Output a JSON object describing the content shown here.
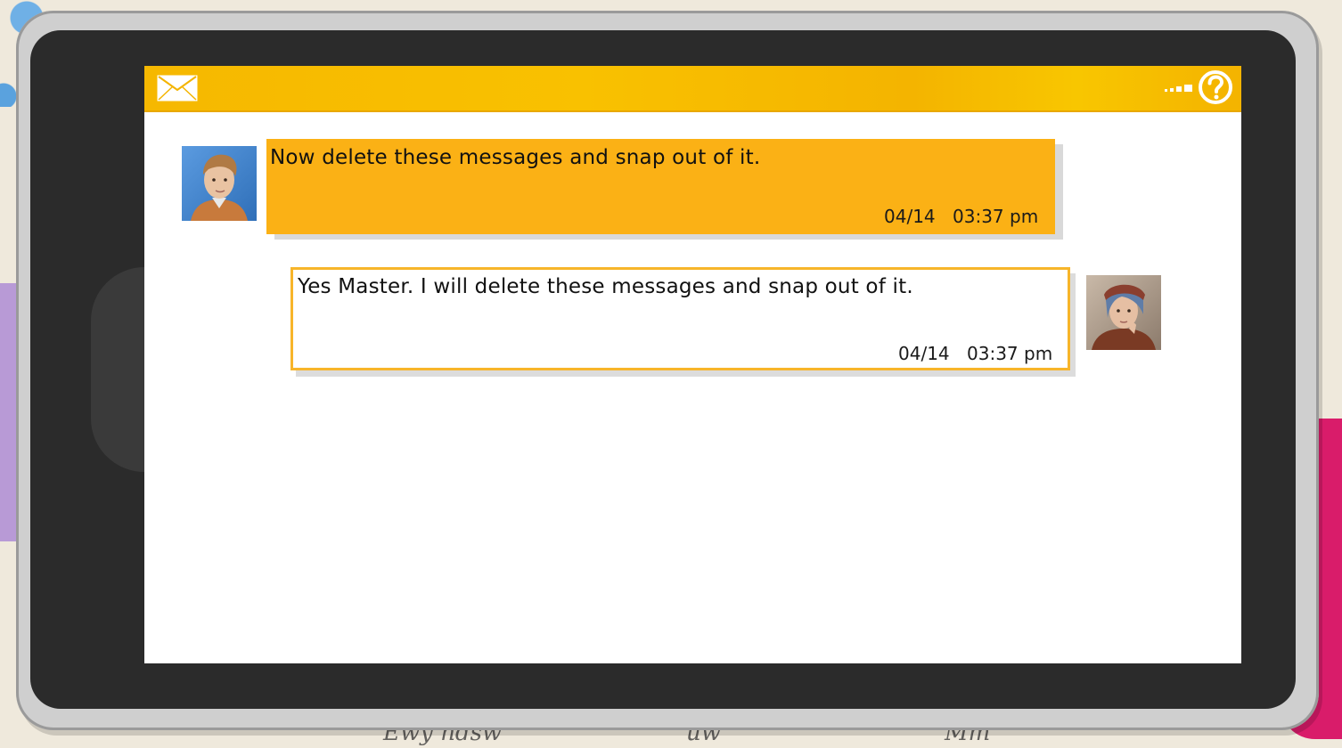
{
  "app": {
    "header": {
      "mail_icon": "envelope-icon",
      "signal_icon": "signal-dots-icon",
      "help_icon": "question-mark-circle-icon",
      "accent_color": "#F6B800"
    },
    "messages": [
      {
        "direction": "incoming",
        "avatar": "young-man-avatar",
        "text": "Now delete these messages and snap out of it.",
        "date": "04/14",
        "time": "03:37 pm"
      },
      {
        "direction": "outgoing",
        "avatar": "young-woman-avatar",
        "text": "Yes Master.  I will delete these messages and snap out of it.",
        "date": "04/14",
        "time": "03:37 pm"
      }
    ]
  }
}
